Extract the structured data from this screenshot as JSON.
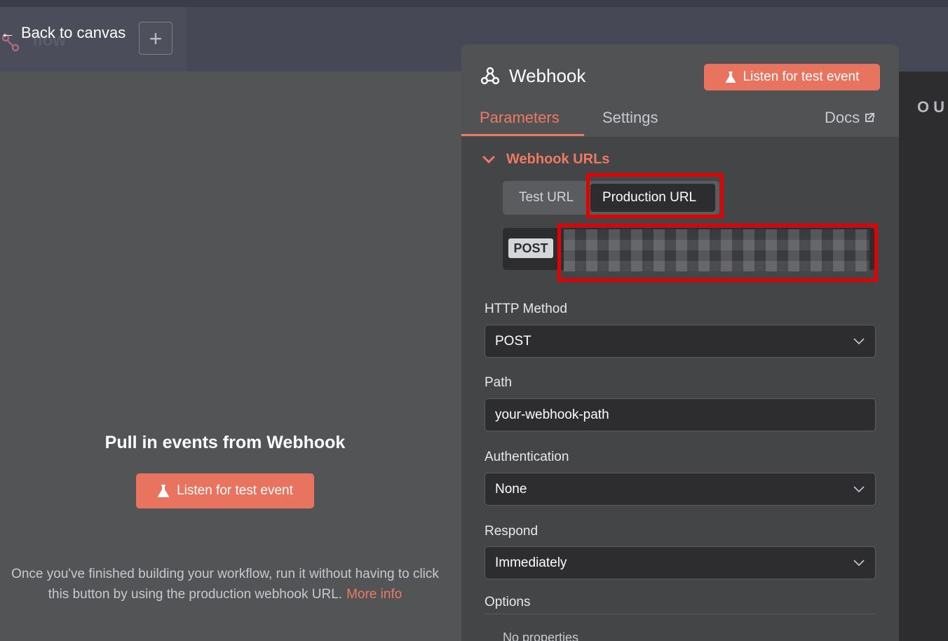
{
  "header": {
    "back_label": "Back to canvas",
    "back_arrow": "←",
    "bg_node_label": "flow",
    "plus_label": "+",
    "right_label": "OU"
  },
  "left": {
    "title": "Pull in events from Webhook",
    "listen_label": "Listen for test event",
    "note": "Once you've finished building your workflow, run it without having to click this button by using the production webhook URL.",
    "more_info": "More info"
  },
  "panel": {
    "title": "Webhook",
    "listen_label": "Listen for test event",
    "tabs": [
      {
        "label": "Parameters",
        "active": true
      },
      {
        "label": "Settings",
        "active": false
      }
    ],
    "docs_label": "Docs",
    "webhook_urls": {
      "heading": "Webhook URLs",
      "options": [
        "Test URL",
        "Production URL"
      ],
      "selected": "Production URL",
      "method_badge": "POST"
    },
    "fields": {
      "http_method": {
        "label": "HTTP Method",
        "value": "POST"
      },
      "path": {
        "label": "Path",
        "value": "your-webhook-path"
      },
      "authentication": {
        "label": "Authentication",
        "value": "None"
      },
      "respond": {
        "label": "Respond",
        "value": "Immediately"
      }
    },
    "options": {
      "label": "Options",
      "empty": "No properties"
    }
  },
  "colors": {
    "accent": "#e8735e",
    "accent_text": "#ee7a63",
    "highlight": "#e00000",
    "panel_bg": "#434547",
    "field_bg": "#2d2d30"
  },
  "icons": [
    "flask-icon",
    "webhook-icon",
    "external-link-icon",
    "chevron-down-icon",
    "arrow-left-icon",
    "plus-icon"
  ]
}
